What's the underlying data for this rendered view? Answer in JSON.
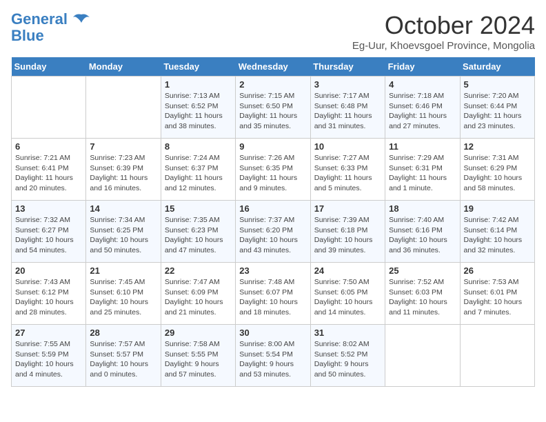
{
  "logo": {
    "line1": "General",
    "line2": "Blue"
  },
  "title": "October 2024",
  "subtitle": "Eg-Uur, Khoevsgoel Province, Mongolia",
  "days_header": [
    "Sunday",
    "Monday",
    "Tuesday",
    "Wednesday",
    "Thursday",
    "Friday",
    "Saturday"
  ],
  "weeks": [
    [
      {
        "day": "",
        "info": ""
      },
      {
        "day": "",
        "info": ""
      },
      {
        "day": "1",
        "info": "Sunrise: 7:13 AM\nSunset: 6:52 PM\nDaylight: 11 hours and 38 minutes."
      },
      {
        "day": "2",
        "info": "Sunrise: 7:15 AM\nSunset: 6:50 PM\nDaylight: 11 hours and 35 minutes."
      },
      {
        "day": "3",
        "info": "Sunrise: 7:17 AM\nSunset: 6:48 PM\nDaylight: 11 hours and 31 minutes."
      },
      {
        "day": "4",
        "info": "Sunrise: 7:18 AM\nSunset: 6:46 PM\nDaylight: 11 hours and 27 minutes."
      },
      {
        "day": "5",
        "info": "Sunrise: 7:20 AM\nSunset: 6:44 PM\nDaylight: 11 hours and 23 minutes."
      }
    ],
    [
      {
        "day": "6",
        "info": "Sunrise: 7:21 AM\nSunset: 6:41 PM\nDaylight: 11 hours and 20 minutes."
      },
      {
        "day": "7",
        "info": "Sunrise: 7:23 AM\nSunset: 6:39 PM\nDaylight: 11 hours and 16 minutes."
      },
      {
        "day": "8",
        "info": "Sunrise: 7:24 AM\nSunset: 6:37 PM\nDaylight: 11 hours and 12 minutes."
      },
      {
        "day": "9",
        "info": "Sunrise: 7:26 AM\nSunset: 6:35 PM\nDaylight: 11 hours and 9 minutes."
      },
      {
        "day": "10",
        "info": "Sunrise: 7:27 AM\nSunset: 6:33 PM\nDaylight: 11 hours and 5 minutes."
      },
      {
        "day": "11",
        "info": "Sunrise: 7:29 AM\nSunset: 6:31 PM\nDaylight: 11 hours and 1 minute."
      },
      {
        "day": "12",
        "info": "Sunrise: 7:31 AM\nSunset: 6:29 PM\nDaylight: 10 hours and 58 minutes."
      }
    ],
    [
      {
        "day": "13",
        "info": "Sunrise: 7:32 AM\nSunset: 6:27 PM\nDaylight: 10 hours and 54 minutes."
      },
      {
        "day": "14",
        "info": "Sunrise: 7:34 AM\nSunset: 6:25 PM\nDaylight: 10 hours and 50 minutes."
      },
      {
        "day": "15",
        "info": "Sunrise: 7:35 AM\nSunset: 6:23 PM\nDaylight: 10 hours and 47 minutes."
      },
      {
        "day": "16",
        "info": "Sunrise: 7:37 AM\nSunset: 6:20 PM\nDaylight: 10 hours and 43 minutes."
      },
      {
        "day": "17",
        "info": "Sunrise: 7:39 AM\nSunset: 6:18 PM\nDaylight: 10 hours and 39 minutes."
      },
      {
        "day": "18",
        "info": "Sunrise: 7:40 AM\nSunset: 6:16 PM\nDaylight: 10 hours and 36 minutes."
      },
      {
        "day": "19",
        "info": "Sunrise: 7:42 AM\nSunset: 6:14 PM\nDaylight: 10 hours and 32 minutes."
      }
    ],
    [
      {
        "day": "20",
        "info": "Sunrise: 7:43 AM\nSunset: 6:12 PM\nDaylight: 10 hours and 28 minutes."
      },
      {
        "day": "21",
        "info": "Sunrise: 7:45 AM\nSunset: 6:10 PM\nDaylight: 10 hours and 25 minutes."
      },
      {
        "day": "22",
        "info": "Sunrise: 7:47 AM\nSunset: 6:09 PM\nDaylight: 10 hours and 21 minutes."
      },
      {
        "day": "23",
        "info": "Sunrise: 7:48 AM\nSunset: 6:07 PM\nDaylight: 10 hours and 18 minutes."
      },
      {
        "day": "24",
        "info": "Sunrise: 7:50 AM\nSunset: 6:05 PM\nDaylight: 10 hours and 14 minutes."
      },
      {
        "day": "25",
        "info": "Sunrise: 7:52 AM\nSunset: 6:03 PM\nDaylight: 10 hours and 11 minutes."
      },
      {
        "day": "26",
        "info": "Sunrise: 7:53 AM\nSunset: 6:01 PM\nDaylight: 10 hours and 7 minutes."
      }
    ],
    [
      {
        "day": "27",
        "info": "Sunrise: 7:55 AM\nSunset: 5:59 PM\nDaylight: 10 hours and 4 minutes."
      },
      {
        "day": "28",
        "info": "Sunrise: 7:57 AM\nSunset: 5:57 PM\nDaylight: 10 hours and 0 minutes."
      },
      {
        "day": "29",
        "info": "Sunrise: 7:58 AM\nSunset: 5:55 PM\nDaylight: 9 hours and 57 minutes."
      },
      {
        "day": "30",
        "info": "Sunrise: 8:00 AM\nSunset: 5:54 PM\nDaylight: 9 hours and 53 minutes."
      },
      {
        "day": "31",
        "info": "Sunrise: 8:02 AM\nSunset: 5:52 PM\nDaylight: 9 hours and 50 minutes."
      },
      {
        "day": "",
        "info": ""
      },
      {
        "day": "",
        "info": ""
      }
    ]
  ]
}
